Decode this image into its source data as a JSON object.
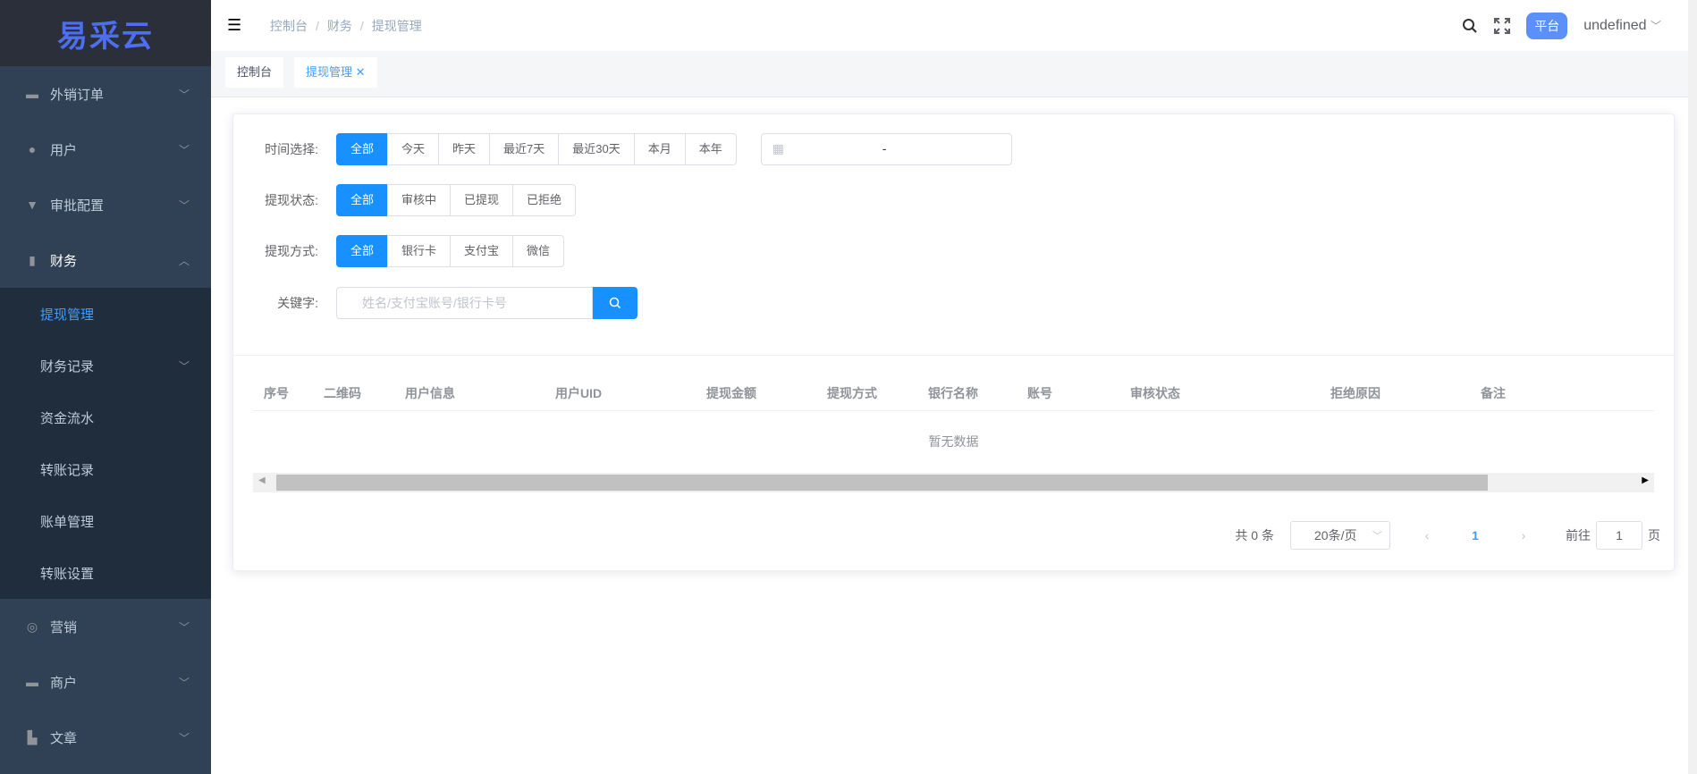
{
  "logo": "易采云",
  "sidebar": {
    "items": [
      {
        "label": "外销订单",
        "icon": "briefcase-icon"
      },
      {
        "label": "用户",
        "icon": "user-icon"
      },
      {
        "label": "审批配置",
        "icon": "stamp-icon"
      },
      {
        "label": "财务",
        "icon": "bar-chart-icon"
      },
      {
        "label": "营销",
        "icon": "lifebuoy-icon"
      },
      {
        "label": "商户",
        "icon": "store-icon"
      },
      {
        "label": "文章",
        "icon": "book-icon"
      }
    ],
    "finance_sub": [
      "提现管理",
      "财务记录",
      "资金流水",
      "转账记录",
      "账单管理",
      "转账设置"
    ]
  },
  "header": {
    "breadcrumb": [
      "控制台",
      "财务",
      "提现管理"
    ],
    "badge": "平台",
    "user": "undefined"
  },
  "tabs": [
    {
      "label": "控制台"
    },
    {
      "label": "提现管理"
    }
  ],
  "filters": {
    "time": {
      "label": "时间选择:",
      "options": [
        "全部",
        "今天",
        "昨天",
        "最近7天",
        "最近30天",
        "本月",
        "本年"
      ],
      "date_sep": "-"
    },
    "status": {
      "label": "提现状态:",
      "options": [
        "全部",
        "审核中",
        "已提现",
        "已拒绝"
      ]
    },
    "method": {
      "label": "提现方式:",
      "options": [
        "全部",
        "银行卡",
        "支付宝",
        "微信"
      ]
    },
    "keyword": {
      "label": "关键字:",
      "placeholder": "姓名/支付宝账号/银行卡号"
    }
  },
  "table": {
    "columns": [
      "序号",
      "二维码",
      "用户信息",
      "用户UID",
      "提现金额",
      "提现方式",
      "银行名称",
      "账号",
      "审核状态",
      "拒绝原因",
      "备注"
    ],
    "empty": "暂无数据"
  },
  "pagination": {
    "total": "共 0 条",
    "page_size": "20条/页",
    "current": "1",
    "goto": "前往",
    "goto_value": "1",
    "page_unit": "页"
  }
}
